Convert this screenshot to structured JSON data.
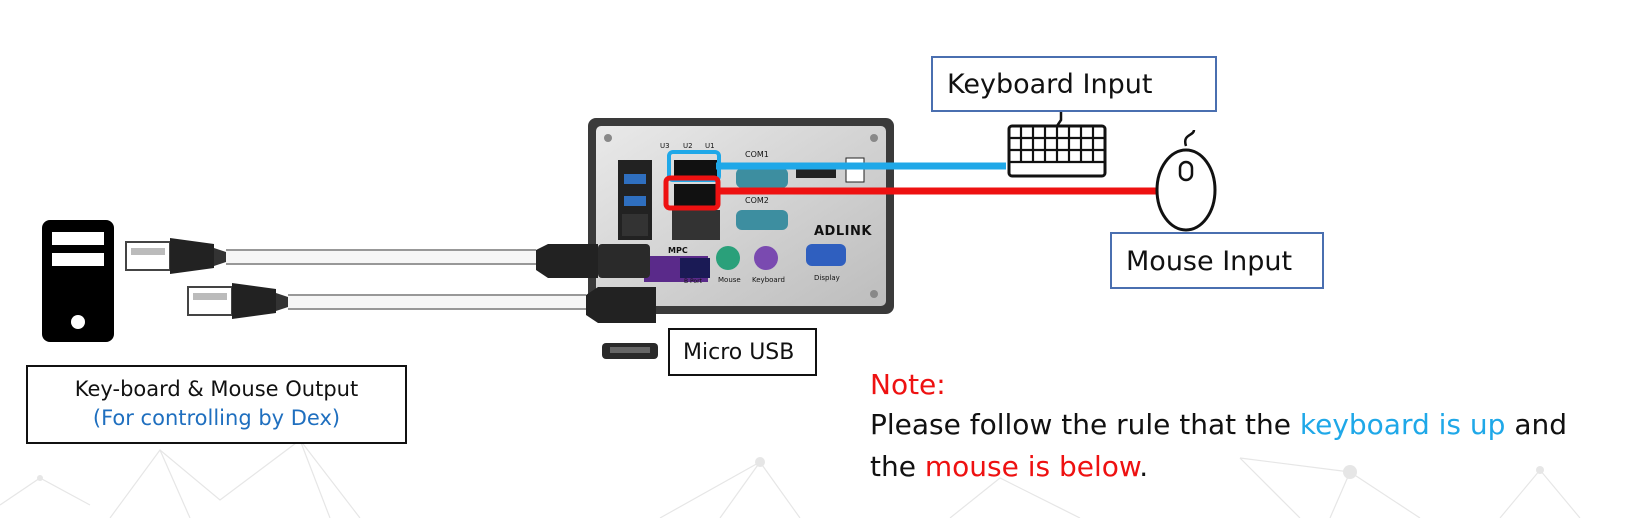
{
  "labels": {
    "keyboard_input": "Keyboard Input",
    "mouse_input": "Mouse Input",
    "micro_usb": "Micro USB",
    "output_line1": "Key-board  & Mouse Output",
    "output_line2": "(For controlling by Dex)"
  },
  "device": {
    "brand": "ADLINK",
    "ports": {
      "u3": "U3",
      "u2": "U2",
      "u1": "U1",
      "com1": "COM1",
      "com2": "COM2",
      "mpc": "MPC",
      "mouse": "Mouse",
      "keyboard": "Keyboard",
      "display": "Display",
      "usb_port": "B Port"
    }
  },
  "note": {
    "title": "Note:",
    "line1_a": "Please follow the rule that the ",
    "line1_highlight": "keyboard is up",
    "line1_b": " and",
    "line2_a": "the ",
    "line2_highlight": "mouse is below",
    "line2_b": "."
  },
  "colors": {
    "keyboard_wire": "#1fa8e8",
    "mouse_wire": "#ee1111",
    "note_title": "#ee1111",
    "keyboard_text": "#1fa8e8",
    "mouse_text": "#ee1111",
    "output_sub": "#1f6fbf",
    "box_border": "#4a6fb0"
  },
  "icons": [
    "computer-tower-icon",
    "keyboard-icon",
    "mouse-icon",
    "micro-usb-icon",
    "usb-cable-icon",
    "usb-c-connector-icon"
  ]
}
